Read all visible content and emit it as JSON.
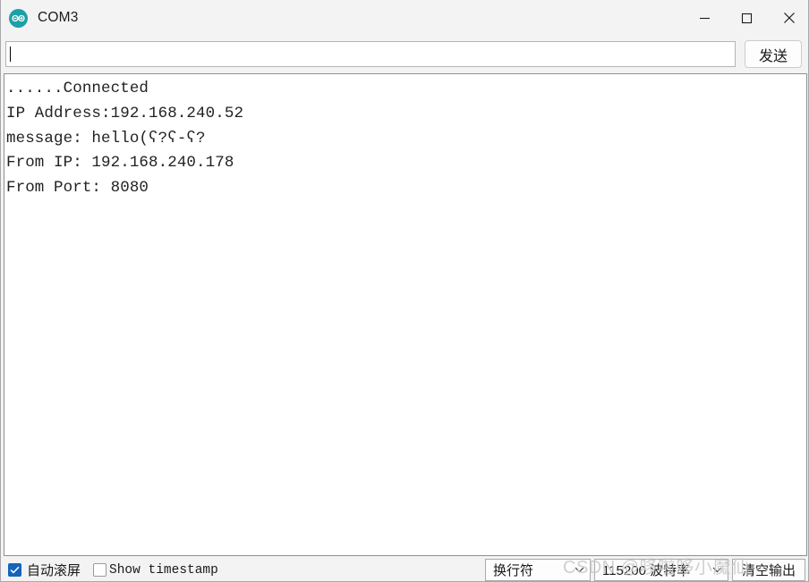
{
  "window": {
    "title": "COM3",
    "icon": "arduino-infinity-icon",
    "controls": {
      "minimize": "minimize-icon",
      "maximize": "maximize-icon",
      "close": "close-icon"
    },
    "titlebar_bg": "#f3f3f3",
    "icon_color": "#1ca0a6"
  },
  "send_row": {
    "input_value": "",
    "input_placeholder": "",
    "send_label": "发送"
  },
  "console": {
    "lines": [
      "......Connected",
      "IP Address:192.168.240.52",
      "message: hello(ʕ?ʕ-ʕ?",
      "From IP: 192.168.240.178",
      "From Port: 8080"
    ],
    "text": "......Connected\nIP Address:192.168.240.52\nmessage: hello(ʕ?ʕ-ʕ?\nFrom IP: 192.168.240.178\nFrom Port: 8080",
    "background": "#ffffff",
    "text_color": "#222222"
  },
  "status_bar": {
    "autoscroll": {
      "label": "自动滚屏",
      "checked": true,
      "accent": "#1464ba"
    },
    "show_timestamp": {
      "label": "Show timestamp",
      "checked": false
    },
    "newline_select": {
      "value": "换行符"
    },
    "baud_select": {
      "value": "115200 波特率"
    },
    "clear_button": {
      "label": "清空输出"
    }
  },
  "watermark": {
    "text": "CSDN @哆啦哆小魔仙",
    "color": "#c8c8c8"
  }
}
